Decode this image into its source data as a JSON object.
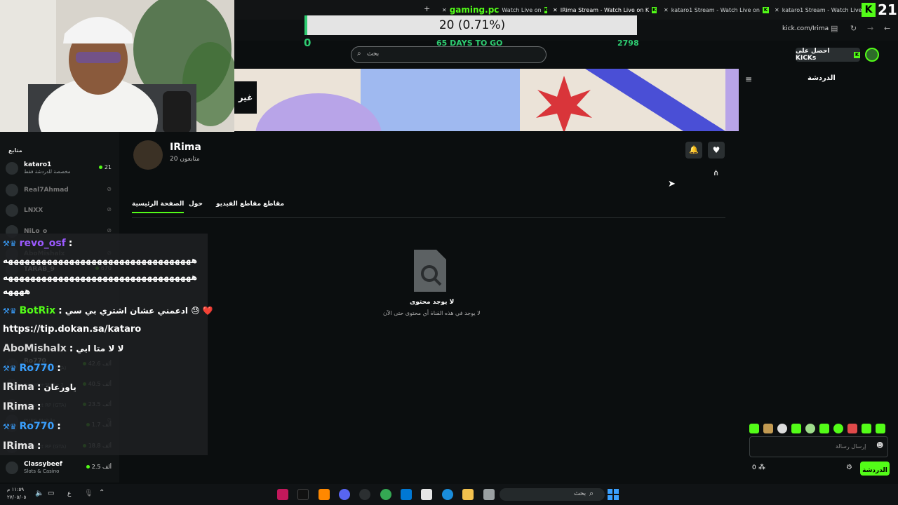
{
  "browser": {
    "tabs": [
      {
        "label": "gaming.pc"
      },
      {
        "label": "Watch Live on"
      },
      {
        "label": "IRima Stream - Watch Live on K"
      },
      {
        "label": "kataro1 Stream - Watch Live on"
      },
      {
        "label": "kataro1 Stream - Watch Live"
      }
    ],
    "new_tab_icon": "+",
    "address": "kick.com/Irima",
    "viewer_badge": "21"
  },
  "goal": {
    "text": "20 (0.71%)",
    "start": "0",
    "end": "2798",
    "days_left": "65 DAYS TO GO",
    "progress": 0.0071,
    "accent": "#2ecc71"
  },
  "header": {
    "search_placeholder": "بحث",
    "get_kicks": "احصل على KICKs"
  },
  "banner": {
    "side_label": "غير"
  },
  "channel": {
    "name": "IRima",
    "followers": "20 متابعون",
    "tabs": [
      "الصفحة الرئيسية",
      "حول",
      "مقاطع الفيديو",
      "مقاطع"
    ],
    "active_tab": 0,
    "empty_title": "لا يوجد محتوى",
    "empty_sub": "لا يوجد في هذه القناة أي محتوى حتى الآن"
  },
  "chat": {
    "title": "الدردشة",
    "input_placeholder": "إرسال رسالة",
    "send_label": "الدردشة",
    "kicks_count": "0"
  },
  "sidebar": {
    "heading": "متابع",
    "channels": [
      {
        "name": "kataro1",
        "sub": "مخصصة للدردشة فقط",
        "count": "21",
        "live": true
      },
      {
        "name": "Real7Ahmad",
        "sub": "",
        "count": "",
        "live": false
      },
      {
        "name": "LNXX",
        "sub": "",
        "count": "",
        "live": false
      },
      {
        "name": "NiLo_o",
        "sub": "",
        "count": "",
        "live": false
      },
      {
        "name": "AboMishalx",
        "sub": "",
        "count": "",
        "live": false
      },
      {
        "name": "TARAB_9",
        "sub": "",
        "count": "670",
        "live": true
      },
      {
        "name": "Ro770",
        "sub": "Respect RP (GTA)",
        "count": "42.6 ألف",
        "live": true
      },
      {
        "name": "",
        "sub": "Counter-Strike 2",
        "count": "40.5 ألف",
        "live": true
      },
      {
        "name": "",
        "sub": "Respect RP (GTA)",
        "count": "23.5 ألف",
        "live": true
      },
      {
        "name": "",
        "sub": "PUBG Mobile",
        "count": "",
        "live": false
      },
      {
        "name": "",
        "sub": "Slots & Casino",
        "count": "1.7 ألف",
        "live": true
      },
      {
        "name": "",
        "sub": "Respect RP (GTA)",
        "count": "18.8 ألف",
        "live": true
      },
      {
        "name": "Classybeef",
        "sub": "Slots & Casino",
        "count": "2.5 ألف",
        "live": true
      }
    ]
  },
  "overlay_chat": [
    {
      "user": "revo_osf",
      "sep": ":",
      "text": ""
    },
    {
      "user": "",
      "sep": "",
      "text": "ههههههههههههههههههههههههههههههههههه"
    },
    {
      "user": "",
      "sep": "",
      "text": "ههههههههههههههههههههههههههههههههههه"
    },
    {
      "user": "",
      "sep": "",
      "text": "ههههه"
    },
    {
      "user": "BotRix",
      "sep": ":",
      "text": "ادعمني عشان اشتري بي سي 😓 ❤️"
    },
    {
      "user": "",
      "sep": "",
      "text": "https://tip.dokan.sa/kataro"
    },
    {
      "user": "AboMishalx",
      "sep": ":",
      "text": "لا لا متا ابي"
    },
    {
      "user": "Ro770",
      "sep": ":",
      "text": ""
    },
    {
      "user": "IRima",
      "sep": ":",
      "text": "ياورعان"
    },
    {
      "user": "IRima",
      "sep": ":",
      "text": ""
    },
    {
      "user": "Ro770",
      "sep": ":",
      "text": ""
    },
    {
      "user": "IRima",
      "sep": ":",
      "text": ""
    }
  ],
  "taskbar": {
    "search": "بحث",
    "time": "١١:٥٩ م",
    "date": "٢٧/٠٥/٠٥",
    "lang": "ع"
  },
  "colors": {
    "kick_green": "#53fc18",
    "bg": "#0b0e0f",
    "overlay_user_purple": "#9b59ff",
    "overlay_user_green": "#53fc18",
    "overlay_user_blue": "#3aa0ff"
  }
}
